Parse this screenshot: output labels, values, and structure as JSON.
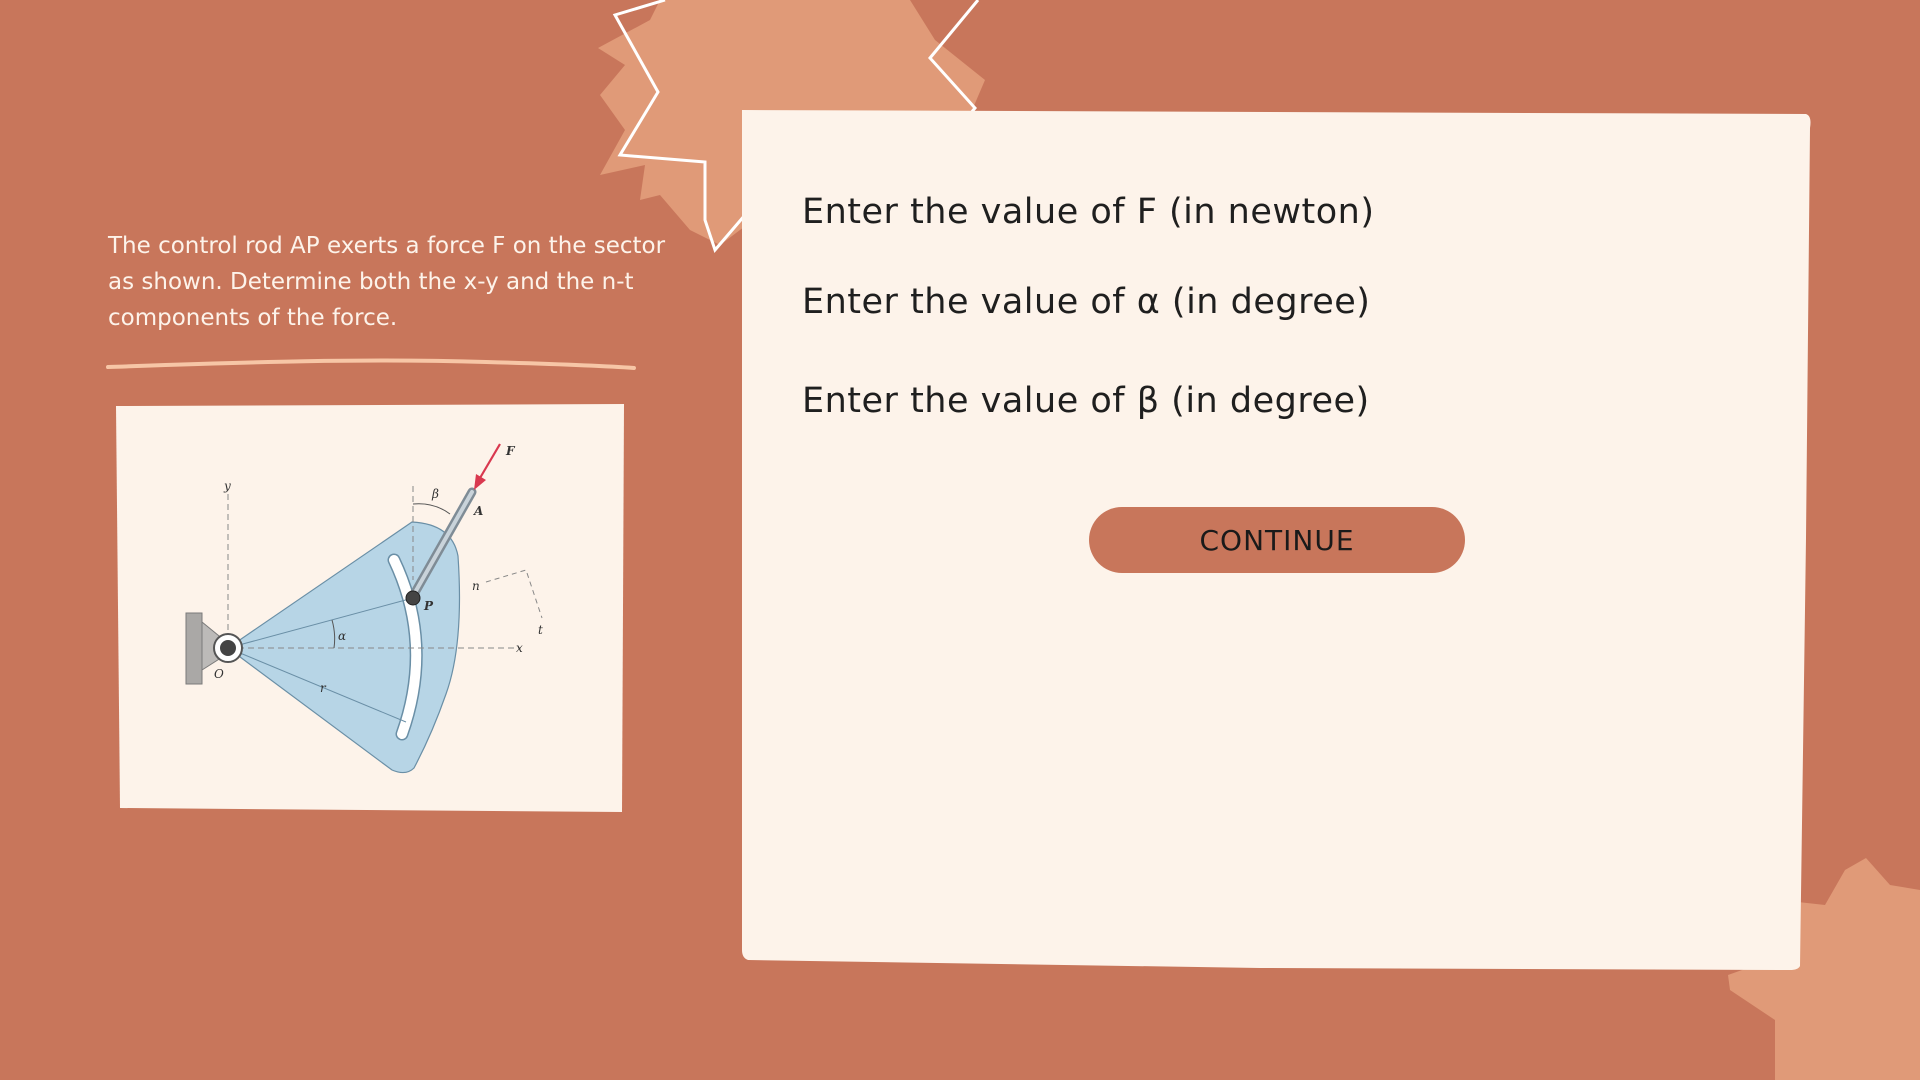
{
  "problem": {
    "text": "The control rod AP exerts a force F on the sector as shown. Determine both the x-y and the n-t components of the force."
  },
  "figure": {
    "labels": {
      "F": "F",
      "A": "A",
      "P": "P",
      "O": "O",
      "x": "x",
      "y": "y",
      "n": "n",
      "t": "t",
      "r": "r",
      "alpha": "α",
      "beta": "β"
    }
  },
  "form": {
    "label_F": "Enter the value of F (in newton)",
    "label_alpha": "Enter the value of α (in degree)",
    "label_beta": "Enter the value of β (in degree)",
    "continue_label": "CONTINUE"
  },
  "colors": {
    "background": "#c8765b",
    "panel": "#fdf3ea",
    "decoration": "#e09a78",
    "sector": "#b7d5e6",
    "force_arrow": "#d9384f"
  }
}
